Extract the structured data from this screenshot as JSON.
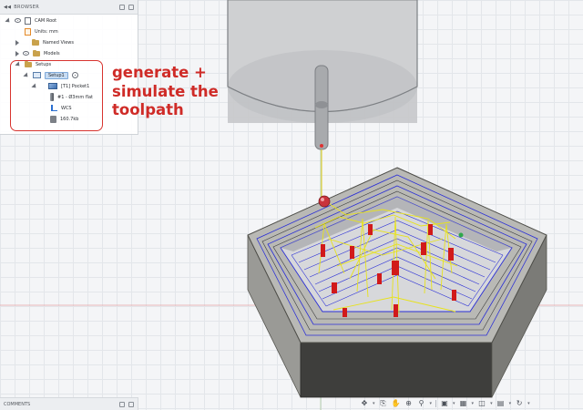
{
  "browser": {
    "title": "BROWSER",
    "items": [
      {
        "label": "CAM Root"
      },
      {
        "label": "Units: mm"
      },
      {
        "label": "Named Views"
      },
      {
        "label": "Models"
      },
      {
        "label": "Setups"
      },
      {
        "label": "Setup1"
      },
      {
        "label": "[T1] Pocket1"
      },
      {
        "label": "#1 - Ø3mm flat"
      },
      {
        "label": "WCS"
      },
      {
        "label": "160.7kb"
      }
    ]
  },
  "callout": {
    "text": "generate +\nsimulate the\ntoolpath",
    "color": "#cf2b27"
  },
  "comments": {
    "label": "COMMENTS"
  },
  "nav_toolbar": {
    "icons": [
      "orbit-icon",
      "pan-icon",
      "hand-icon",
      "zoom-fit-icon",
      "zoom-icon",
      "display-settings-icon",
      "grid-icon",
      "viewports-icon",
      "environment-icon",
      "effects-icon"
    ]
  },
  "colors": {
    "toolpath_blue": "#2b2fd6",
    "rapid_yellow": "#e7e21c",
    "plunge_red": "#d11a1a",
    "stock": "#8a8a88"
  }
}
